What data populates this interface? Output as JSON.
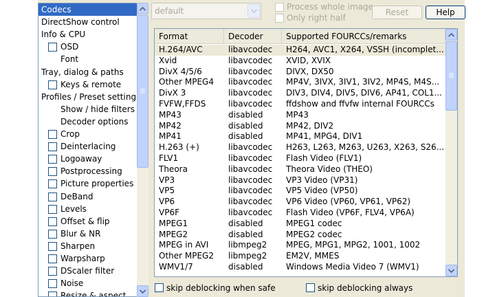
{
  "tree": {
    "items": [
      {
        "label": "Codecs",
        "checkbox": false,
        "selected": true
      },
      {
        "label": "DirectShow control",
        "checkbox": false
      },
      {
        "label": "Info & CPU",
        "checkbox": false
      },
      {
        "label": "OSD",
        "checkbox": true
      },
      {
        "label": "Font",
        "checkbox": false
      },
      {
        "label": "Tray, dialog & paths",
        "checkbox": false
      },
      {
        "label": "Keys & remote",
        "checkbox": true
      },
      {
        "label": "Profiles / Preset settings",
        "checkbox": false
      },
      {
        "label": "Show / hide filters",
        "checkbox": false
      },
      {
        "label": "Decoder options",
        "checkbox": false
      },
      {
        "label": "Crop",
        "checkbox": true
      },
      {
        "label": "Deinterlacing",
        "checkbox": true
      },
      {
        "label": "Logoaway",
        "checkbox": true
      },
      {
        "label": "Postprocessing",
        "checkbox": true
      },
      {
        "label": "Picture properties",
        "checkbox": true
      },
      {
        "label": "DeBand",
        "checkbox": true
      },
      {
        "label": "Levels",
        "checkbox": true
      },
      {
        "label": "Offset & flip",
        "checkbox": true
      },
      {
        "label": "Blur & NR",
        "checkbox": true
      },
      {
        "label": "Sharpen",
        "checkbox": true
      },
      {
        "label": "Warpsharp",
        "checkbox": true
      },
      {
        "label": "DScaler filter",
        "checkbox": true
      },
      {
        "label": "Noise",
        "checkbox": true
      },
      {
        "label": "Resize & aspect",
        "checkbox": true
      }
    ]
  },
  "toolbar": {
    "preset_value": "default",
    "process_whole_image": "Process whole image",
    "only_right_half": "Only right half",
    "reset_label": "Reset",
    "help_label": "Help"
  },
  "codec_list": {
    "headers": [
      "Format",
      "Decoder",
      "Supported FOURCCs/remarks"
    ],
    "rows": [
      [
        "H.264/AVC",
        "libavcodec",
        "H264, AVC1, X264, VSSH (incomplet..."
      ],
      [
        "Xvid",
        "libavcodec",
        "XVID, XVIX"
      ],
      [
        "DivX 4/5/6",
        "libavcodec",
        "DIVX, DX50"
      ],
      [
        "Other MPEG4",
        "libavcodec",
        "MP4V, 3IVX, 3IV1, 3IV2, MP4S, M4S..."
      ],
      [
        "DivX 3",
        "libavcodec",
        "DIV3, DIV4, DIV5, DIV6, AP41, COL1..."
      ],
      [
        "FVFW,FFDS",
        "libavcodec",
        "ffdshow and ffvfw internal FOURCCs"
      ],
      [
        "MP43",
        "disabled",
        "MP43"
      ],
      [
        "MP42",
        "disabled",
        "MP42, DIV2"
      ],
      [
        "MP41",
        "disabled",
        "MP41, MPG4, DIV1"
      ],
      [
        "H.263 (+)",
        "libavcodec",
        "H263, L263, M263, U263, X263, S26..."
      ],
      [
        "FLV1",
        "libavcodec",
        "Flash Video (FLV1)"
      ],
      [
        "Theora",
        "libavcodec",
        "Theora Video (THEO)"
      ],
      [
        "VP3",
        "libavcodec",
        "VP3 Video (VP31)"
      ],
      [
        "VP5",
        "libavcodec",
        "VP5 Video (VP50)"
      ],
      [
        "VP6",
        "libavcodec",
        "VP6 Video (VP60, VP61, VP62)"
      ],
      [
        "VP6F",
        "libavcodec",
        "Flash Video (VP6F, FLV4, VP6A)"
      ],
      [
        "MPEG1",
        "disabled",
        "MPEG1 codec"
      ],
      [
        "MPEG2",
        "disabled",
        "MPEG2 codec"
      ],
      [
        "MPEG in AVI",
        "libmpeg2",
        "MPEG, MPG1, MPG2, 1001, 1002"
      ],
      [
        "Other MPEG2",
        "libmpeg2",
        "EM2V, MMES"
      ],
      [
        "WMV1/7",
        "disabled",
        "Windows Media Video 7 (WMV1)"
      ]
    ]
  },
  "options": {
    "skip_deblocking_safe": "skip deblocking when safe",
    "skip_deblocking_always": "skip deblocking always"
  },
  "icons": {
    "scroll_up": "scroll-up-arrow-icon",
    "scroll_down": "scroll-down-arrow-icon",
    "combo_dropdown": "chevron-down-icon"
  },
  "colors": {
    "selection": "#316ac5",
    "dialog_bg": "#ece9d8",
    "border": "#7f9db9",
    "scroll_button": "#c1d3fb"
  }
}
